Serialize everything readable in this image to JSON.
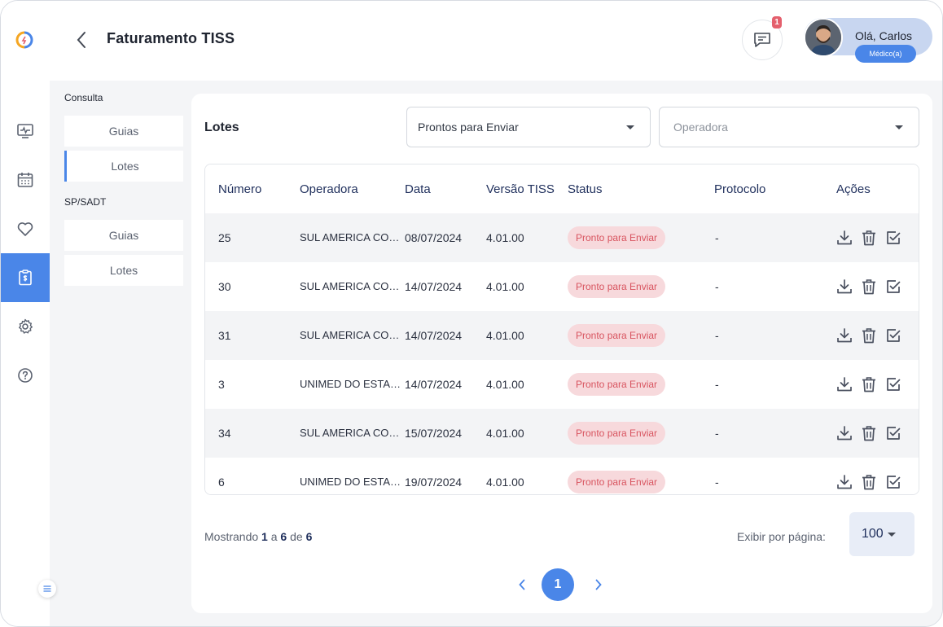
{
  "header": {
    "title": "Faturamento TISS",
    "notifications_count": "1",
    "user_greeting": "Olá, Carlos",
    "user_role": "Médico(a)"
  },
  "rail": {
    "items": [
      {
        "icon": "monitor-icon"
      },
      {
        "icon": "calendar-icon"
      },
      {
        "icon": "heart-icon"
      },
      {
        "icon": "billing-clipboard-icon",
        "active": true
      },
      {
        "icon": "gear-icon"
      },
      {
        "icon": "help-icon"
      }
    ]
  },
  "subnav": {
    "sections": [
      {
        "label": "Consulta",
        "items": [
          {
            "label": "Guias"
          },
          {
            "label": "Lotes",
            "active": true
          }
        ]
      },
      {
        "label": "SP/SADT",
        "items": [
          {
            "label": "Guias"
          },
          {
            "label": "Lotes"
          }
        ]
      }
    ]
  },
  "main": {
    "title": "Lotes",
    "status_filter": {
      "value": "Prontos para Enviar"
    },
    "operadora_filter": {
      "placeholder": "Operadora"
    },
    "columns": [
      "Número",
      "Operadora",
      "Data",
      "Versão TISS",
      "Status",
      "Protocolo",
      "Ações"
    ],
    "rows": [
      {
        "numero": "25",
        "operadora": "SUL AMERICA COMPANHIA DE SEGURO SAUDE",
        "data": "08/07/2024",
        "versao": "4.01.00",
        "status": "Pronto para Enviar",
        "protocolo": "-"
      },
      {
        "numero": "30",
        "operadora": "SUL AMERICA COMPANHIA DE SEGURO SAUDE",
        "data": "14/07/2024",
        "versao": "4.01.00",
        "status": "Pronto para Enviar",
        "protocolo": "-"
      },
      {
        "numero": "31",
        "operadora": "SUL AMERICA COMPANHIA DE SEGURO SAUDE",
        "data": "14/07/2024",
        "versao": "4.01.00",
        "status": "Pronto para Enviar",
        "protocolo": "-"
      },
      {
        "numero": "3",
        "operadora": "UNIMED DO ESTADO DE SAO PAULO",
        "data": "14/07/2024",
        "versao": "4.01.00",
        "status": "Pronto para Enviar",
        "protocolo": "-"
      },
      {
        "numero": "34",
        "operadora": "SUL AMERICA COMPANHIA DE SEGURO SAUDE",
        "data": "15/07/2024",
        "versao": "4.01.00",
        "status": "Pronto para Enviar",
        "protocolo": "-"
      },
      {
        "numero": "6",
        "operadora": "UNIMED DO ESTADO DE SAO PAULO",
        "data": "19/07/2024",
        "versao": "4.01.00",
        "status": "Pronto para Enviar",
        "protocolo": "-"
      }
    ],
    "row_actions": [
      "download-icon",
      "trash-icon",
      "check-square-icon"
    ]
  },
  "footer": {
    "showing_prefix": "Mostrando",
    "showing_from": "1",
    "showing_mid": "a",
    "showing_to": "6",
    "showing_of": "de",
    "showing_total": "6",
    "per_page_label": "Exibir por página:",
    "per_page_value": "100",
    "current_page": "1"
  },
  "colors": {
    "accent": "#4a86e8",
    "status_bg": "#f7d9dc",
    "status_text": "#d8545f",
    "badge": "#e4606d"
  }
}
